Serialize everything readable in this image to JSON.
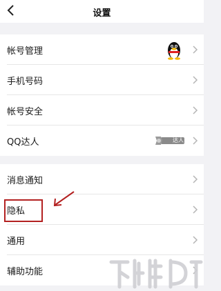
{
  "header": {
    "title": "设置"
  },
  "group1": [
    {
      "label": "帐号管理"
    },
    {
      "label": "手机号码"
    },
    {
      "label": "帐号安全"
    },
    {
      "label": "QQ达人",
      "badge": "达人"
    }
  ],
  "group2": [
    {
      "label": "消息通知"
    },
    {
      "label": "隐私"
    },
    {
      "label": "通用"
    },
    {
      "label": "辅助功能"
    }
  ],
  "colors": {
    "highlight": "#b32020",
    "background": "#f2f2f5",
    "chevron": "#b5b5b5"
  }
}
